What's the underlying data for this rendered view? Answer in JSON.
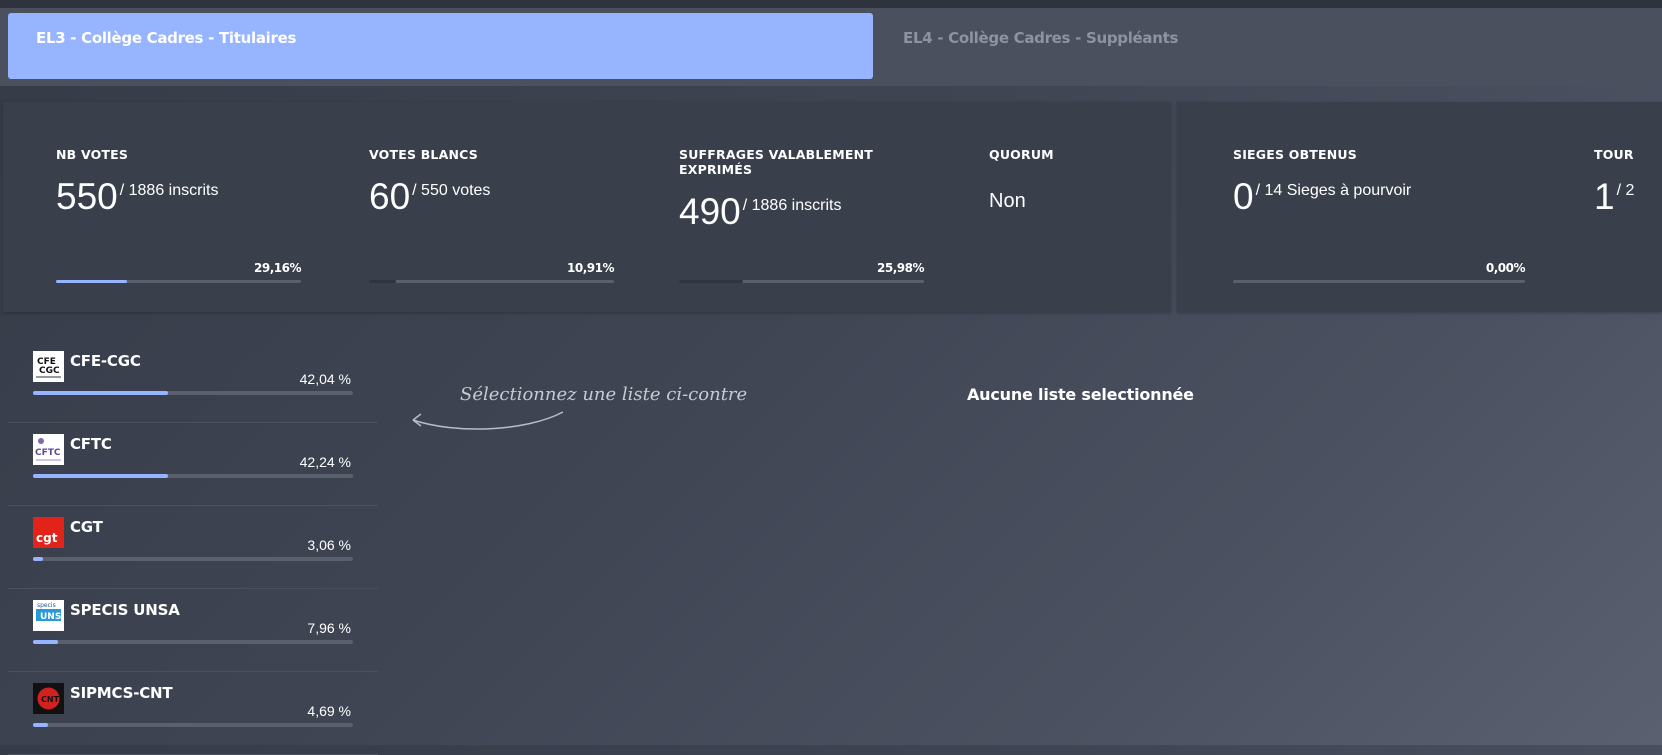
{
  "tabs": [
    {
      "label": "EL3 - Collège Cadres - Titulaires",
      "active": true
    },
    {
      "label": "EL4 - Collège Cadres - Suppléants",
      "active": false
    }
  ],
  "stats": {
    "nb_votes": {
      "label": "NB VOTES",
      "value": "550",
      "sub": "/ 1886 inscrits",
      "pct": "29,16%",
      "fill": 0.2916
    },
    "votes_blancs": {
      "label": "VOTES BLANCS",
      "value": "60",
      "sub": "/ 550 votes",
      "pct": "10,91%",
      "fill": 0.1091
    },
    "suffrages": {
      "label": "SUFFRAGES VALABLEMENT EXPRIMÉS",
      "value": "490",
      "sub": "/ 1886 inscrits",
      "pct": "25,98%",
      "fill": 0.2598
    },
    "quorum": {
      "label": "QUORUM",
      "value": "Non"
    },
    "sieges": {
      "label": "SIEGES OBTENUS",
      "value": "0",
      "sub": "/ 14 Sieges à pourvoir",
      "pct": "0,00%",
      "fill": 0.0
    },
    "tour": {
      "label": "TOUR",
      "value": "1",
      "sub": "/ 2"
    }
  },
  "parties": [
    {
      "name": "CFE-CGC",
      "pct": "42,04 %",
      "fill": 0.4204,
      "logo": "cfe-cgc-logo"
    },
    {
      "name": "CFTC",
      "pct": "42,24 %",
      "fill": 0.4224,
      "logo": "cftc-logo"
    },
    {
      "name": "CGT",
      "pct": "3,06 %",
      "fill": 0.0306,
      "logo": "cgt-logo"
    },
    {
      "name": "SPECIS UNSA",
      "pct": "7,96 %",
      "fill": 0.0796,
      "logo": "specis-unsa-logo"
    },
    {
      "name": "SIPMCS-CNT",
      "pct": "4,69 %",
      "fill": 0.0469,
      "logo": "sipmcs-cnt-logo"
    }
  ],
  "hint": "Sélectionnez une liste ci-contre",
  "no_selection": "Aucune liste selectionnée",
  "colors": {
    "accent": "#96b4ff",
    "panel": "#3a404b",
    "track": "#5a606c"
  }
}
